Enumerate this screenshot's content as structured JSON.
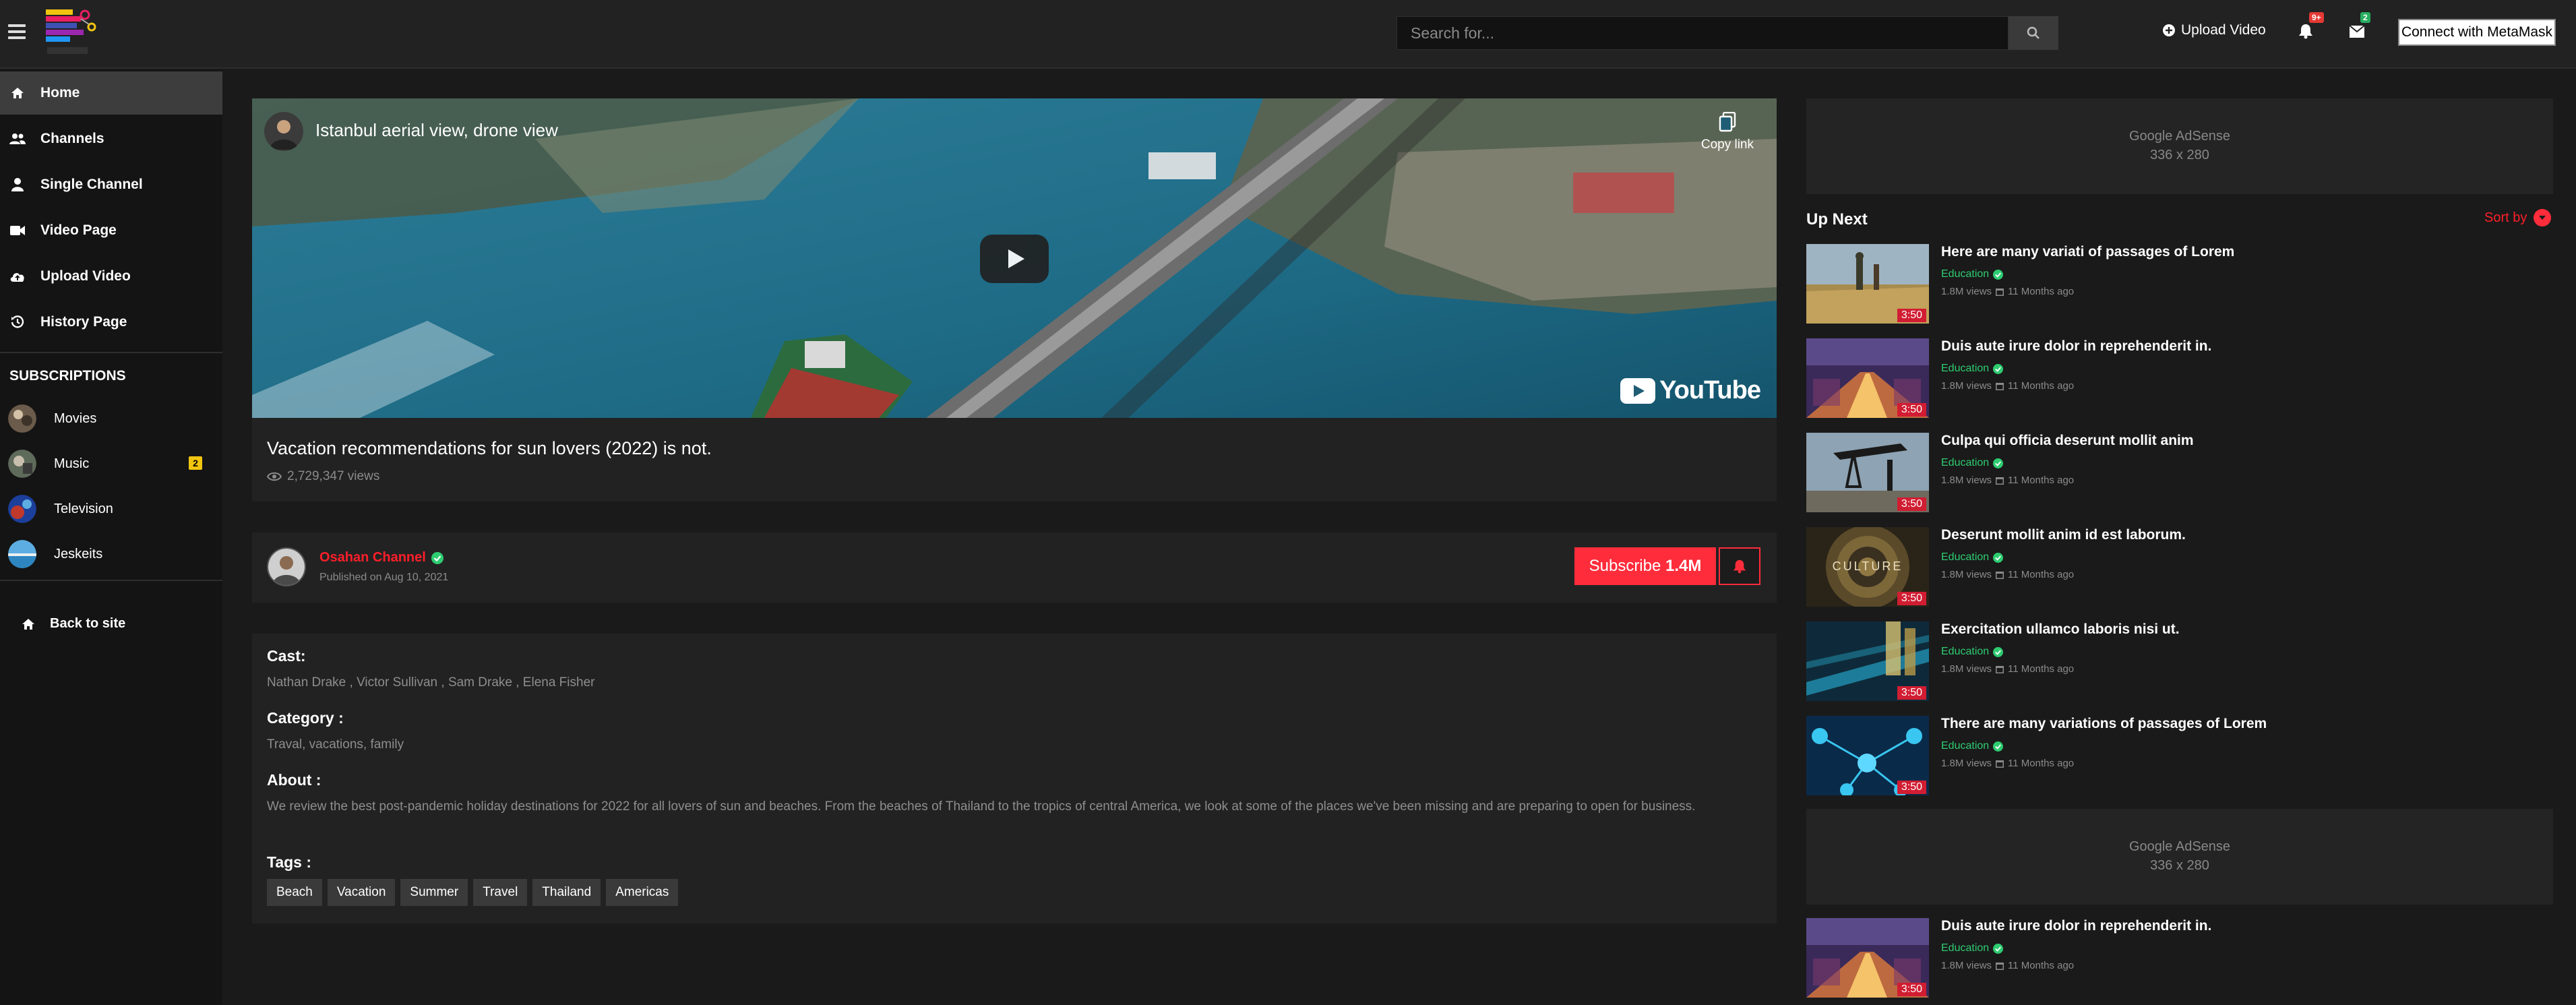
{
  "header": {
    "search_placeholder": "Search for...",
    "upload_label": "Upload Video",
    "notifications_badge": "9+",
    "messages_badge": "2",
    "metamask_label": "Connect with MetaMask",
    "logo_icon": "app-logo"
  },
  "sidebar": {
    "items": [
      {
        "label": "Home",
        "icon": "home-icon",
        "active": true
      },
      {
        "label": "Channels",
        "icon": "users-icon"
      },
      {
        "label": "Single Channel",
        "icon": "user-icon"
      },
      {
        "label": "Video Page",
        "icon": "video-camera-icon"
      },
      {
        "label": "Upload Video",
        "icon": "cloud-upload-icon"
      },
      {
        "label": "History Page",
        "icon": "history-icon"
      }
    ],
    "subscriptions_title": "SUBSCRIPTIONS",
    "subscriptions": [
      {
        "label": "Movies"
      },
      {
        "label": "Music",
        "count": "2"
      },
      {
        "label": "Television"
      },
      {
        "label": "Jeskeits"
      }
    ],
    "back_label": "Back to site"
  },
  "player": {
    "title": "Istanbul aerial view, drone view",
    "copy_link": "Copy link",
    "youtube_label": "YouTube"
  },
  "video_info": {
    "title": "Vacation recommendations for sun lovers (2022) is not.",
    "views": "2,729,347 views"
  },
  "channel": {
    "name": "Osahan Channel",
    "published": "Published on Aug 10, 2021",
    "subscribe_label": "Subscribe",
    "subscriber_count": "1.4M"
  },
  "details": {
    "cast_heading": "Cast:",
    "cast": "Nathan Drake , Victor Sullivan , Sam Drake , Elena Fisher",
    "category_heading": "Category :",
    "category": "Traval, vacations, family",
    "about_heading": "About :",
    "about": "We review the best post-pandemic holiday destinations for 2022 for all lovers of sun and beaches. From the beaches of Thailand to the tropics of central America, we look at some of the places we've been missing and are preparing to open for business.",
    "tags_heading": "Tags :",
    "tags": [
      "Beach",
      "Vacation",
      "Summer",
      "Travel",
      "Thailand",
      "Americas"
    ]
  },
  "right": {
    "ad_title": "Google AdSense",
    "ad_size": "336 x 280",
    "upnext_title": "Up Next",
    "sort_label": "Sort by",
    "videos": [
      {
        "title": "Here are many variati of passages of Lorem",
        "category": "Education",
        "views": "1.8M views",
        "date": "11 Months ago",
        "duration": "3:50"
      },
      {
        "title": "Duis aute irure dolor in reprehenderit in.",
        "category": "Education",
        "views": "1.8M views",
        "date": "11 Months ago",
        "duration": "3:50"
      },
      {
        "title": "Culpa qui officia deserunt mollit anim",
        "category": "Education",
        "views": "1.8M views",
        "date": "11 Months ago",
        "duration": "3:50"
      },
      {
        "title": "Deserunt mollit anim id est laborum.",
        "category": "Education",
        "views": "1.8M views",
        "date": "11 Months ago",
        "duration": "3:50"
      },
      {
        "title": "Exercitation ullamco laboris nisi ut.",
        "category": "Education",
        "views": "1.8M views",
        "date": "11 Months ago",
        "duration": "3:50"
      },
      {
        "title": "There are many variations of passages of Lorem",
        "category": "Education",
        "views": "1.8M views",
        "date": "11 Months ago",
        "duration": "3:50"
      },
      {
        "title": "Duis aute irure dolor in reprehenderit in.",
        "category": "Education",
        "views": "1.8M views",
        "date": "11 Months ago",
        "duration": "3:50"
      }
    ],
    "culture_text": "CULTURE"
  },
  "colors": {
    "accent_red": "#ff2c3b",
    "verified_green": "#2ecc71",
    "sidebar_bg": "#141414",
    "panel_bg": "#222222"
  }
}
